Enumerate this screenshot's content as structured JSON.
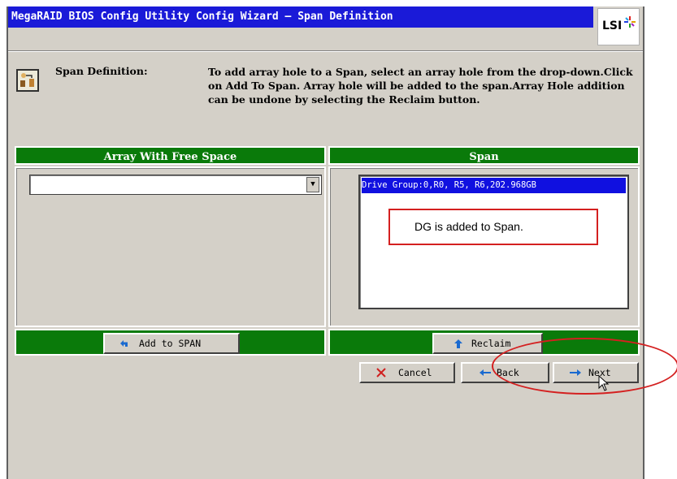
{
  "window": {
    "title": "MegaRAID BIOS Config Utility  Config Wizard – Span Definition",
    "logo_text": "LSI",
    "logo_icon": "lsi-star-logo"
  },
  "info": {
    "label": "Span Definition:",
    "text": "To add array hole to a Span, select an array hole from the drop-down.Click on Add To Span. Array hole will be added to the span.Array Hole addition can be undone by selecting the Reclaim button.",
    "icon": "wizard-info-icon"
  },
  "left_panel": {
    "header": "Array With Free Space",
    "dropdown_value": "",
    "button_label": "Add to SPAN",
    "button_icon": "undo-arrow-icon"
  },
  "right_panel": {
    "header": "Span",
    "items": [
      "Drive Group:0,R0, R5, R6,202.968GB"
    ],
    "button_label": "Reclaim",
    "button_icon": "up-arrow-icon"
  },
  "callout": {
    "text": "DG is added to Span."
  },
  "footer": {
    "cancel_label": "Cancel",
    "back_label": "Back",
    "next_label": "Next"
  },
  "colors": {
    "title_bar": "#1a1ad8",
    "panel_green": "#0a7a0a",
    "selection_blue": "#1010e0",
    "annotation_red": "#d42020",
    "dialog_gray": "#d4d0c8"
  }
}
